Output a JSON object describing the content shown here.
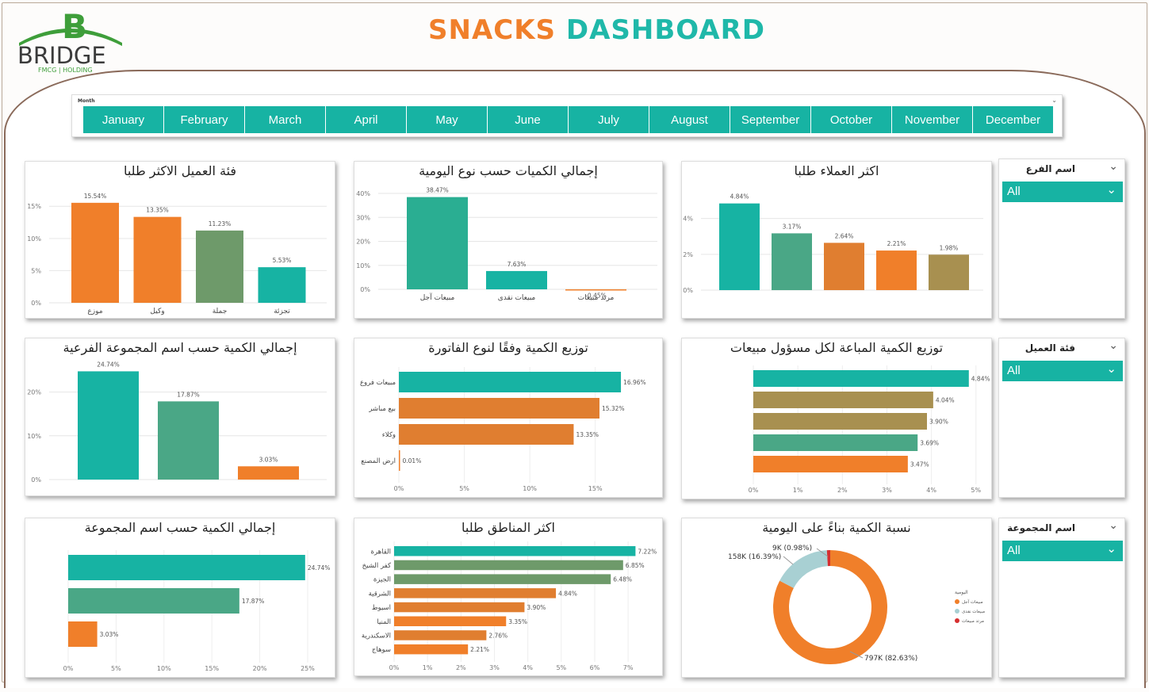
{
  "header": {
    "title_part1": "SNACKS",
    "title_part2": "DASHBOARD",
    "logo_text": "BRIDGE",
    "logo_sub": "FMCG | HOLDING"
  },
  "colors": {
    "teal": "#17b3a3",
    "green": "#4aa786",
    "orange": "#f07f2a",
    "olive": "#6e9a6a",
    "gold": "#a89050"
  },
  "month_slicer": {
    "label": "Month",
    "months": [
      "January",
      "February",
      "March",
      "April",
      "May",
      "June",
      "July",
      "August",
      "September",
      "October",
      "November",
      "December"
    ]
  },
  "filters": [
    {
      "label": "اسم الفرع",
      "value": "All"
    },
    {
      "label": "فئة العميل",
      "value": "All"
    },
    {
      "label": "اسم المجموعة",
      "value": "All"
    }
  ],
  "chart_data": [
    {
      "id": "c1",
      "type": "bar",
      "title": "فئة العميل الاكثر طلبا",
      "categories": [
        "موزع",
        "وكيل",
        "جملة",
        "تجزئة"
      ],
      "values": [
        15.54,
        13.35,
        11.23,
        5.53
      ],
      "labels": [
        "15.54%",
        "13.35%",
        "11.23%",
        "5.53%"
      ],
      "colors": [
        "#f07f2a",
        "#f07f2a",
        "#6e9a6a",
        "#17b3a3"
      ],
      "yticks": [
        "0%",
        "5%",
        "10%",
        "15%"
      ],
      "ylim": [
        0,
        17
      ]
    },
    {
      "id": "c2",
      "type": "bar",
      "title": "إجمالي الكميات حسب نوع اليومية",
      "categories": [
        "مبيعات آجل",
        "مبيعات نقدى",
        "مرتد مبيعات"
      ],
      "values": [
        38.47,
        7.63,
        -0.45
      ],
      "labels": [
        "38.47%",
        "7.63%",
        "-0.45%"
      ],
      "colors": [
        "#2aae92",
        "#17b3a3",
        "#f07f2a"
      ],
      "yticks": [
        "0%",
        "10%",
        "20%",
        "30%",
        "40%"
      ],
      "ylim": [
        0,
        40
      ]
    },
    {
      "id": "c3",
      "type": "bar",
      "title": "اكثر العملاء طلبا",
      "categories": [
        "",
        "",
        "",
        "",
        ""
      ],
      "values": [
        4.84,
        3.17,
        2.64,
        2.21,
        1.98
      ],
      "labels": [
        "4.84%",
        "3.17%",
        "2.64%",
        "2.21%",
        "1.98%"
      ],
      "colors": [
        "#17b3a3",
        "#4aa786",
        "#e07e30",
        "#f07f2a",
        "#a89050"
      ],
      "yticks": [
        "0%",
        "2%",
        "4%"
      ],
      "ylim": [
        0,
        5.4
      ]
    },
    {
      "id": "c4",
      "type": "bar",
      "title": "إجمالي الكمية حسب اسم المجموعة الفرعية",
      "categories": [
        "",
        "",
        ""
      ],
      "values": [
        24.74,
        17.87,
        3.03
      ],
      "labels": [
        "24.74%",
        "17.87%",
        "3.03%"
      ],
      "colors": [
        "#17b3a3",
        "#4aa786",
        "#f07f2a"
      ],
      "yticks": [
        "0%",
        "10%",
        "20%"
      ],
      "ylim": [
        0,
        25
      ]
    },
    {
      "id": "c5",
      "type": "hbar",
      "title": "توزيع الكمية وفقًا لنوع الفاتورة",
      "categories": [
        "مبيعات فروع",
        "بيع مباشر",
        "وكلاء",
        "ارض المصنع"
      ],
      "values": [
        16.96,
        15.32,
        13.35,
        0.01
      ],
      "labels": [
        "16.96%",
        "15.32%",
        "13.35%",
        "0.01%"
      ],
      "colors": [
        "#17b3a3",
        "#e07e30",
        "#e07e30",
        "#f07f2a"
      ],
      "xticks": [
        "0%",
        "5%",
        "10%",
        "15%"
      ],
      "xlim": [
        0,
        19.5
      ]
    },
    {
      "id": "c6",
      "type": "hbar",
      "title": "توزيع الكمية المباعة لكل مسؤول مبيعات",
      "categories": [
        "",
        "",
        "",
        "",
        ""
      ],
      "values": [
        4.84,
        4.04,
        3.9,
        3.69,
        3.47
      ],
      "labels": [
        "4.84%",
        "4.04%",
        "3.90%",
        "3.69%",
        "3.47%"
      ],
      "colors": [
        "#17b3a3",
        "#a89050",
        "#a89050",
        "#4aa786",
        "#f07f2a"
      ],
      "xticks": [
        "0%",
        "1%",
        "2%",
        "3%",
        "4%",
        "5%"
      ],
      "xlim": [
        0,
        5.2
      ]
    },
    {
      "id": "c7",
      "type": "hbar",
      "title": "إجمالي الكمية حسب اسم المجموعة",
      "categories": [
        "",
        "",
        ""
      ],
      "values": [
        24.74,
        17.87,
        3.03
      ],
      "labels": [
        "24.74%",
        "17.87%",
        "3.03%"
      ],
      "colors": [
        "#17b3a3",
        "#4aa786",
        "#f07f2a"
      ],
      "xticks": [
        "0%",
        "5%",
        "10%",
        "15%",
        "20%",
        "25%"
      ],
      "xlim": [
        0,
        25.5
      ]
    },
    {
      "id": "c8",
      "type": "hbar",
      "title": "اكثر المناطق طلبا",
      "categories": [
        "القاهرة",
        "كفر الشيخ",
        "الجيزة",
        "الشرقية",
        "اسيوط",
        "المنيا",
        "الاسكندرية",
        "سوهاج"
      ],
      "values": [
        7.22,
        6.85,
        6.48,
        4.84,
        3.9,
        3.35,
        2.76,
        2.21
      ],
      "labels": [
        "7.22%",
        "6.85%",
        "6.48%",
        "4.84%",
        "3.90%",
        "3.35%",
        "2.76%",
        "2.21%"
      ],
      "colors": [
        "#17b3a3",
        "#6e9a6a",
        "#6e9a6a",
        "#e07e30",
        "#e07e30",
        "#f07f2a",
        "#e07e30",
        "#f07f2a"
      ],
      "xticks": [
        "0%",
        "1%",
        "2%",
        "3%",
        "4%",
        "5%",
        "6%",
        "7%"
      ],
      "xlim": [
        0,
        7.4
      ]
    },
    {
      "id": "c9",
      "type": "pie",
      "title": "نسبة الكمية بناءً على اليومية",
      "legend_title": "اليومية",
      "slices": [
        {
          "name": "مبيعات آجل",
          "value": 82.63,
          "label": "797K (82.63%)",
          "color": "#f07f2a"
        },
        {
          "name": "مبيعات نقدى",
          "value": 16.39,
          "label": "158K (16.39%)",
          "color": "#a8d0d3"
        },
        {
          "name": "مرتد مبيعات",
          "value": 0.98,
          "label": "9K (0.98%)",
          "color": "#d62f2f"
        }
      ]
    }
  ]
}
